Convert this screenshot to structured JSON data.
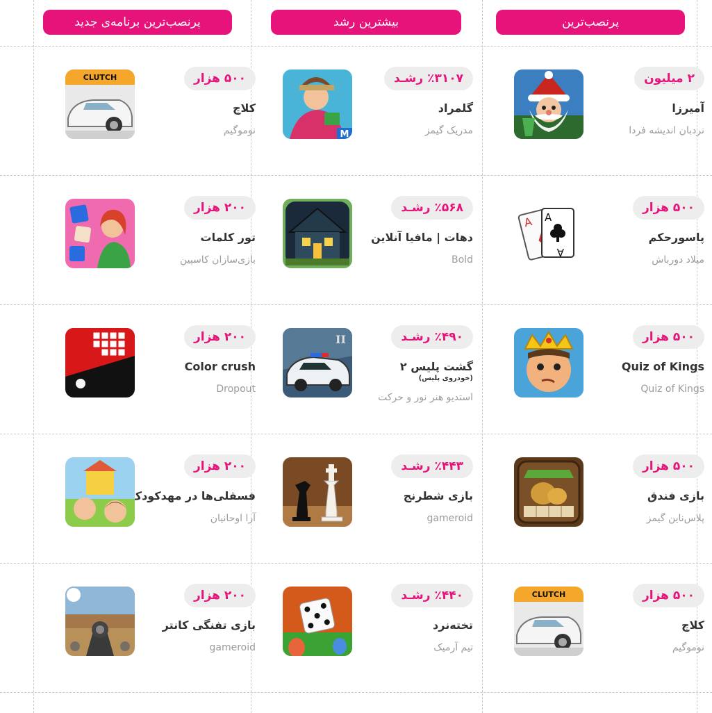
{
  "headers": {
    "most_installed": "پرنصب‌ترین",
    "most_growth": "بیشترین رشد",
    "most_installed_new": "پرنصب‌ترین برنامه‌ی جدید"
  },
  "columns": {
    "most_installed": [
      {
        "badge": "۲ میلیون",
        "name": "آمیرزا",
        "developer": "نردبان اندیشه فردا",
        "icon": "amirza-santa-icon"
      },
      {
        "badge": "۵۰۰ هزار",
        "name": "پاسورحکم",
        "developer": "میلاد دورباش",
        "icon": "playing-cards-icon"
      },
      {
        "badge": "۵۰۰ هزار",
        "name": "Quiz of Kings",
        "developer": "Quiz of Kings",
        "icon": "crowned-king-icon"
      },
      {
        "badge": "۵۰۰ هزار",
        "name": "بازی فندق",
        "developer": "پلاس‌ناین گیمز",
        "icon": "hazelnut-icon"
      },
      {
        "badge": "۵۰۰ هزار",
        "name": "کلاچ",
        "developer": "نوموگیم",
        "icon": "clutch-car-icon"
      }
    ],
    "most_growth": [
      {
        "badge": "٪۳۱۰۷ رشـد",
        "name": "گلمراد",
        "developer": "مدریک گیمز",
        "icon": "golmorad-woman-icon"
      },
      {
        "badge": "٪۵۶۸ رشـد",
        "name": "دهات | مافیا آنلاین",
        "developer": "Bold",
        "icon": "village-house-icon"
      },
      {
        "badge": "٪۴۹۰ رشـد",
        "name": "گشت پلیس ۲",
        "subtitle": "(خودروی پلیس)",
        "developer": "استدیو هنر نور و حرکت",
        "icon": "police-car-icon"
      },
      {
        "badge": "٪۴۴۳ رشـد",
        "name": "بازی شطرنج",
        "developer": "gameroid",
        "icon": "chess-pieces-icon"
      },
      {
        "badge": "٪۴۴۰ رشـد",
        "name": "تخته‌نرد",
        "developer": "تیم آرمیک",
        "icon": "dice-icon"
      }
    ],
    "most_installed_new": [
      {
        "badge": "۵۰۰ هزار",
        "name": "کلاچ",
        "developer": "نوموگیم",
        "icon": "clutch-car-icon"
      },
      {
        "badge": "۲۰۰ هزار",
        "name": "تور کلمات",
        "developer": "بازی‌سازان کاسپین",
        "icon": "word-tour-icon"
      },
      {
        "badge": "۲۰۰ هزار",
        "name": "Color crush",
        "developer": "Dropout",
        "icon": "color-crush-icon"
      },
      {
        "badge": "۲۰۰ هزار",
        "name": "فسقلی‌ها در مهدکودک",
        "developer": "آرا اوحانیان",
        "icon": "kindergarten-kids-icon"
      },
      {
        "badge": "۲۰۰ هزار",
        "name": "بازی تفنگی کانتر",
        "developer": "gameroid",
        "icon": "counter-gun-icon"
      }
    ]
  },
  "colors": {
    "accent": "#e6137a",
    "badge_bg": "#ededed",
    "muted_text": "#9b9b9b"
  }
}
